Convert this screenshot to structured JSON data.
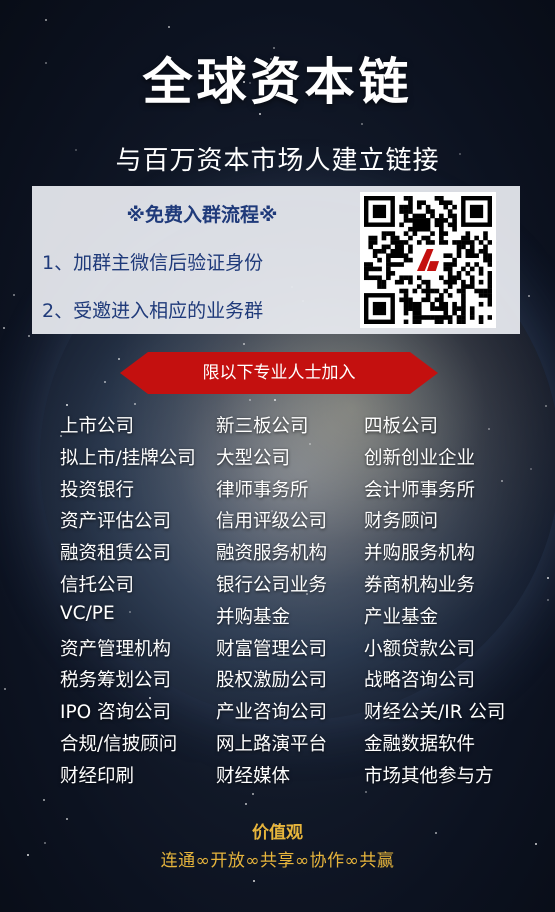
{
  "header": {
    "title": "全球资本链",
    "subtitle": "与百万资本市场人建立链接"
  },
  "panel": {
    "heading": "※免费入群流程※",
    "steps": [
      "1、加群主微信后验证身份",
      "2、受邀进入相应的业务群"
    ]
  },
  "banner": {
    "label": "限以下专业人士加入",
    "color": "#c4100f"
  },
  "categories": [
    [
      "上市公司",
      "新三板公司",
      "四板公司"
    ],
    [
      "拟上市/挂牌公司",
      "大型公司",
      "创新创业企业"
    ],
    [
      "投资银行",
      "律师事务所",
      "会计师事务所"
    ],
    [
      "资产评估公司",
      "信用评级公司",
      "财务顾问"
    ],
    [
      "融资租赁公司",
      "融资服务机构",
      "并购服务机构"
    ],
    [
      "信托公司",
      "银行公司业务",
      "券商机构业务"
    ],
    [
      "VC/PE",
      "并购基金",
      "产业基金"
    ],
    [
      "资产管理机构",
      "财富管理公司",
      "小额贷款公司"
    ],
    [
      "税务筹划公司",
      "股权激励公司",
      "战略咨询公司"
    ],
    [
      "IPO 咨询公司",
      "产业咨询公司",
      "财经公关/IR 公司"
    ],
    [
      "合规/信披顾问",
      "网上路演平台",
      "金融数据软件"
    ],
    [
      "财经印刷",
      "财经媒体",
      "市场其他参与方"
    ]
  ],
  "footer": {
    "values_title": "价值观",
    "values_line": "连通∞开放∞共享∞协作∞共赢",
    "accent_color": "#e7b53c"
  },
  "icons": {
    "qr": "qr-code-icon",
    "logo": "red-logo-icon"
  }
}
